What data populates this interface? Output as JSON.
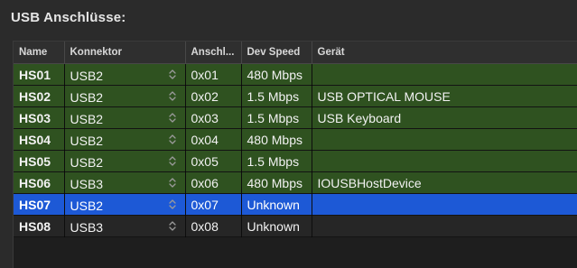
{
  "panel": {
    "title": "USB Anschlüsse:"
  },
  "table": {
    "columns": {
      "name": "Name",
      "konnektor": "Konnektor",
      "anschluss": "Anschl...",
      "dev_speed": "Dev Speed",
      "geraet": "Gerät"
    },
    "rows": [
      {
        "name": "HS01",
        "konnektor": "USB2",
        "anschluss": "0x01",
        "dev_speed": "480 Mbps",
        "geraet": ""
      },
      {
        "name": "HS02",
        "konnektor": "USB2",
        "anschluss": "0x02",
        "dev_speed": "1.5 Mbps",
        "geraet": "USB OPTICAL MOUSE"
      },
      {
        "name": "HS03",
        "konnektor": "USB2",
        "anschluss": "0x03",
        "dev_speed": "1.5 Mbps",
        "geraet": "USB Keyboard"
      },
      {
        "name": "HS04",
        "konnektor": "USB2",
        "anschluss": "0x04",
        "dev_speed": "480 Mbps",
        "geraet": ""
      },
      {
        "name": "HS05",
        "konnektor": "USB2",
        "anschluss": "0x05",
        "dev_speed": "1.5 Mbps",
        "geraet": ""
      },
      {
        "name": "HS06",
        "konnektor": "USB3",
        "anschluss": "0x06",
        "dev_speed": "480 Mbps",
        "geraet": "IOUSBHostDevice"
      },
      {
        "name": "HS07",
        "konnektor": "USB2",
        "anschluss": "0x07",
        "dev_speed": "Unknown",
        "geraet": ""
      },
      {
        "name": "HS08",
        "konnektor": "USB3",
        "anschluss": "0x08",
        "dev_speed": "Unknown",
        "geraet": ""
      }
    ],
    "selected_row": "HS07"
  },
  "colors": {
    "active_row": "#2f5220",
    "selected_row": "#1d59d6",
    "inactive_row": "#262626"
  },
  "icons": {
    "konnektor_popup": "stepper-updown-icon"
  }
}
